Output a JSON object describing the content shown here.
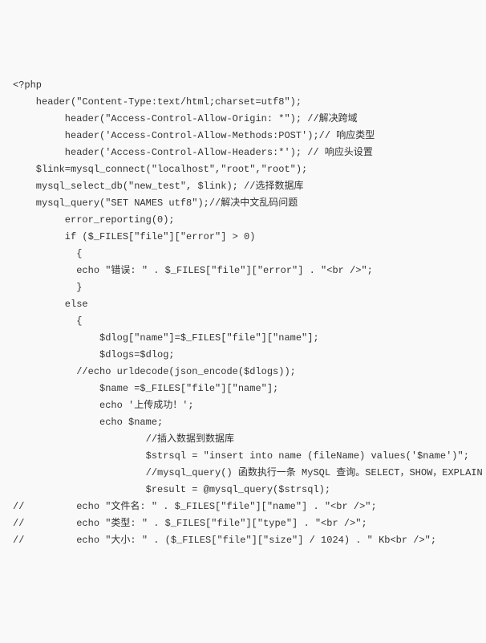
{
  "code": {
    "lines": [
      "<?php",
      "    header(\"Content-Type:text/html;charset=utf8\");",
      "         header(\"Access-Control-Allow-Origin: *\"); //解决跨域",
      "         header('Access-Control-Allow-Methods:POST');// 响应类型",
      "         header('Access-Control-Allow-Headers:*'); // 响应头设置",
      "    $link=mysql_connect(\"localhost\",\"root\",\"root\");",
      "    mysql_select_db(\"new_test\", $link); //选择数据库",
      "    mysql_query(\"SET NAMES utf8\");//解决中文乱码问题",
      "         error_reporting(0);",
      "         if ($_FILES[\"file\"][\"error\"] > 0)",
      "           {",
      "           echo \"错误: \" . $_FILES[\"file\"][\"error\"] . \"<br />\";",
      "           }",
      "         else",
      "           {",
      "               $dlog[\"name\"]=$_FILES[\"file\"][\"name\"];",
      "               $dlogs=$dlog;",
      "           //echo urldecode(json_encode($dlogs));",
      "               $name =$_FILES[\"file\"][\"name\"];",
      "               echo '上传成功！';",
      "               echo $name;",
      "                       //插入数据到数据库",
      "                       $strsql = \"insert into name (fileName) values('$name')\";",
      "                       //mysql_query() 函数执行一条 MySQL 查询。SELECT，SHOW，EXPLAIN",
      "                       $result = @mysql_query($strsql);",
      "//         echo \"文件名: \" . $_FILES[\"file\"][\"name\"] . \"<br />\";",
      "//         echo \"类型: \" . $_FILES[\"file\"][\"type\"] . \"<br />\";",
      "//         echo \"大小: \" . ($_FILES[\"file\"][\"size\"] / 1024) . \" Kb<br />\";"
    ]
  }
}
